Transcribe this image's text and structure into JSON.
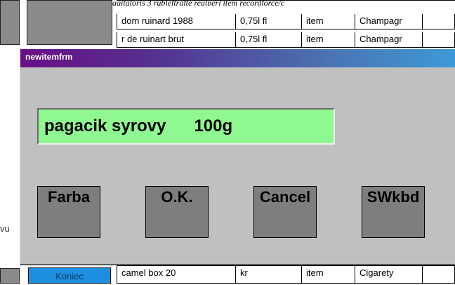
{
  "background": {
    "top_fragment": "agitatoris 3 rubleftrafte reglperl item recordforce/c"
  },
  "grid": {
    "rows": [
      {
        "name": "dom ruinard 1988",
        "qty": "0,75l fl",
        "type": "item",
        "category": "Champagr"
      },
      {
        "name": "r de ruinart brut",
        "qty": "0,75l fl",
        "type": "item",
        "category": "Champagr"
      },
      {
        "name": "camel box 20",
        "qty": "kr",
        "type": "item",
        "category": "Cigarety"
      }
    ]
  },
  "left_panel": {
    "koniec_label": "Koniec",
    "side_fragment": "vu"
  },
  "dialog": {
    "title": "newitemfrm",
    "item_value": "pagacik syrovy      100g",
    "buttons": {
      "farba": "Farba",
      "ok": "O.K.",
      "cancel": "Cancel",
      "swkbd": "SWkbd"
    }
  },
  "colors": {
    "field_green": "#90f890",
    "koniec_blue": "#1e8fe0",
    "dialog_gray": "#c0c0c0",
    "button_gray": "#7e7e7e"
  }
}
